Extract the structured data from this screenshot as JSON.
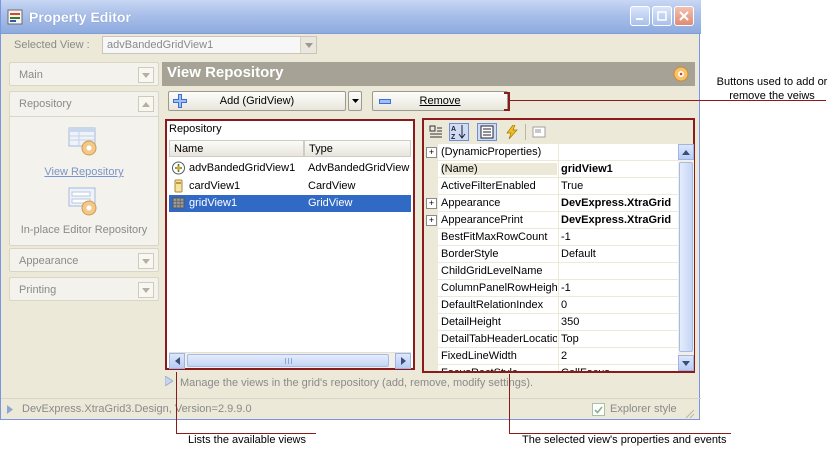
{
  "window": {
    "title": "Property Editor"
  },
  "selected_view": {
    "label": "Selected View :",
    "value": "advBandedGridView1"
  },
  "nav": {
    "groups": [
      {
        "label": "Main"
      },
      {
        "label": "Repository",
        "items": [
          {
            "label": "View Repository"
          },
          {
            "label": "In-place Editor Repository"
          }
        ]
      },
      {
        "label": "Appearance"
      },
      {
        "label": "Printing"
      }
    ]
  },
  "repo": {
    "header": "View Repository",
    "add_label": "Add (GridView)",
    "remove_label": "Remove",
    "list_title": "Repository",
    "columns": [
      "Name",
      "Type"
    ],
    "rows": [
      {
        "name": "advBandedGridView1",
        "type": "AdvBandedGridView",
        "icon": "banded-grid-icon"
      },
      {
        "name": "cardView1",
        "type": "CardView",
        "icon": "card-view-icon"
      },
      {
        "name": "gridView1",
        "type": "GridView",
        "icon": "grid-view-icon",
        "selected": true
      }
    ]
  },
  "props": {
    "rows": [
      {
        "name": "(DynamicProperties)",
        "value": "",
        "expand": true
      },
      {
        "name": "(Name)",
        "value": "gridView1",
        "bold": true,
        "selected": true
      },
      {
        "name": "ActiveFilterEnabled",
        "value": "True"
      },
      {
        "name": "Appearance",
        "value": "DevExpress.XtraGrid",
        "bold": true,
        "expand": true
      },
      {
        "name": "AppearancePrint",
        "value": "DevExpress.XtraGrid",
        "bold": true,
        "expand": true
      },
      {
        "name": "BestFitMaxRowCount",
        "value": "-1"
      },
      {
        "name": "BorderStyle",
        "value": "Default"
      },
      {
        "name": "ChildGridLevelName",
        "value": ""
      },
      {
        "name": "ColumnPanelRowHeight",
        "value": "-1"
      },
      {
        "name": "DefaultRelationIndex",
        "value": "0"
      },
      {
        "name": "DetailHeight",
        "value": "350"
      },
      {
        "name": "DetailTabHeaderLocation",
        "value": "Top"
      },
      {
        "name": "FixedLineWidth",
        "value": "2"
      },
      {
        "name": "FocusRectStyle",
        "value": "CellFocus"
      }
    ]
  },
  "description": "Manage the views in the grid's repository (add, remove, modify settings).",
  "status": {
    "text": "DevExpress.XtraGrid3.Design, Version=2.9.9.0",
    "explorer_label": "Explorer style",
    "explorer_checked": true
  },
  "annotations": {
    "buttons": "Buttons used to add or remove the veiws",
    "list": "Lists the available views",
    "props": "The selected view's properties and events"
  },
  "colors": {
    "accent_frame": "#8b1a1a",
    "selection": "#316ac5",
    "window_bg": "#ece9d8"
  }
}
